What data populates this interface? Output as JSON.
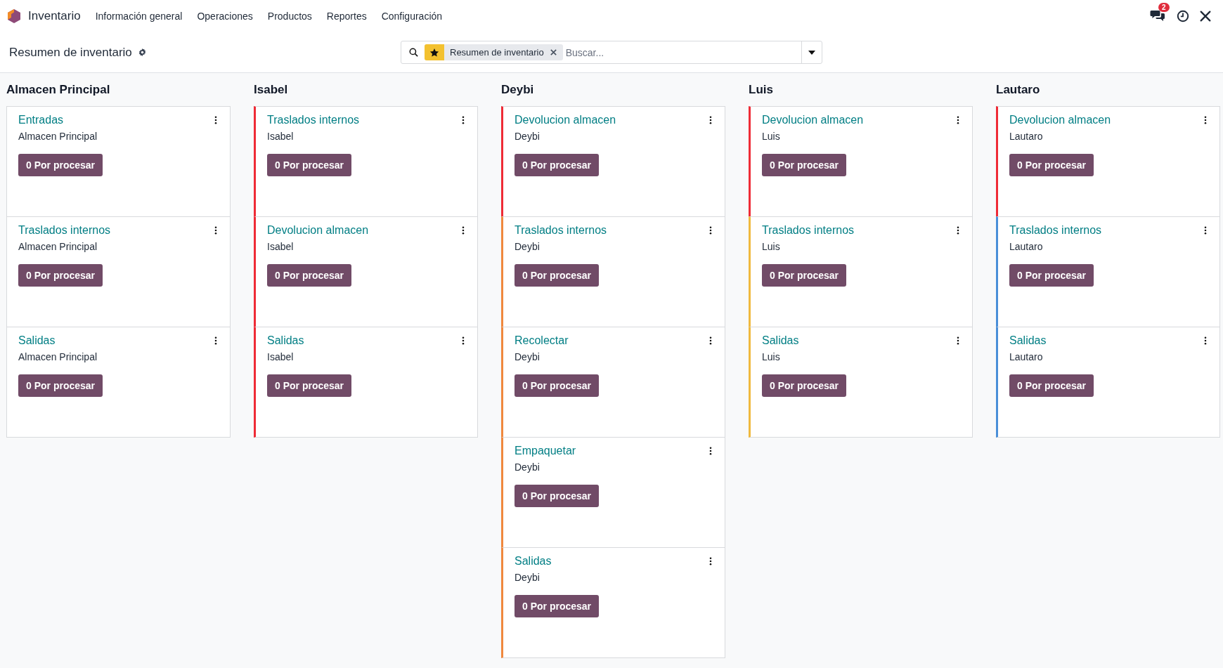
{
  "navbar": {
    "app_name": "Inventario",
    "menu": [
      "Información general",
      "Operaciones",
      "Productos",
      "Reportes",
      "Configuración"
    ],
    "messages_badge": "2"
  },
  "control_panel": {
    "title": "Resumen de inventario",
    "search": {
      "facet": "Resumen de inventario",
      "placeholder": "Buscar..."
    }
  },
  "columns": [
    {
      "title": "Almacen Principal",
      "cards": [
        {
          "title": "Entradas",
          "warehouse": "Almacen Principal",
          "button": "0 Por procesar"
        },
        {
          "title": "Traslados internos",
          "warehouse": "Almacen Principal",
          "button": "0 Por procesar"
        },
        {
          "title": "Salidas",
          "warehouse": "Almacen Principal",
          "button": "0 Por procesar"
        }
      ]
    },
    {
      "title": "Isabel",
      "cards": [
        {
          "title": "Traslados internos",
          "warehouse": "Isabel",
          "button": "0 Por procesar",
          "color": "#ef2b36"
        },
        {
          "title": "Devolucion almacen",
          "warehouse": "Isabel",
          "button": "0 Por procesar",
          "color": "#ef2b36"
        },
        {
          "title": "Salidas",
          "warehouse": "Isabel",
          "button": "0 Por procesar",
          "color": "#ef2b36"
        }
      ]
    },
    {
      "title": "Deybi",
      "cards": [
        {
          "title": "Devolucion almacen",
          "warehouse": "Deybi",
          "button": "0 Por procesar",
          "color": "#ef2b36"
        },
        {
          "title": "Traslados internos",
          "warehouse": "Deybi",
          "button": "0 Por procesar",
          "color": "#f0883e"
        },
        {
          "title": "Recolectar",
          "warehouse": "Deybi",
          "button": "0 Por procesar",
          "color": "#f0883e"
        },
        {
          "title": "Empaquetar",
          "warehouse": "Deybi",
          "button": "0 Por procesar",
          "color": "#f0883e"
        },
        {
          "title": "Salidas",
          "warehouse": "Deybi",
          "button": "0 Por procesar",
          "color": "#f0883e"
        }
      ]
    },
    {
      "title": "Luis",
      "cards": [
        {
          "title": "Devolucion almacen",
          "warehouse": "Luis",
          "button": "0 Por procesar",
          "color": "#ef2b36"
        },
        {
          "title": "Traslados internos",
          "warehouse": "Luis",
          "button": "0 Por procesar",
          "color": "#f0b93e"
        },
        {
          "title": "Salidas",
          "warehouse": "Luis",
          "button": "0 Por procesar",
          "color": "#f0b93e"
        }
      ]
    },
    {
      "title": "Lautaro",
      "cards": [
        {
          "title": "Devolucion almacen",
          "warehouse": "Lautaro",
          "button": "0 Por procesar",
          "color": "#ef2b36"
        },
        {
          "title": "Traslados internos",
          "warehouse": "Lautaro",
          "button": "0 Por procesar",
          "color": "#4a8fd8"
        },
        {
          "title": "Salidas",
          "warehouse": "Lautaro",
          "button": "0 Por procesar",
          "color": "#4a8fd8"
        }
      ]
    }
  ]
}
